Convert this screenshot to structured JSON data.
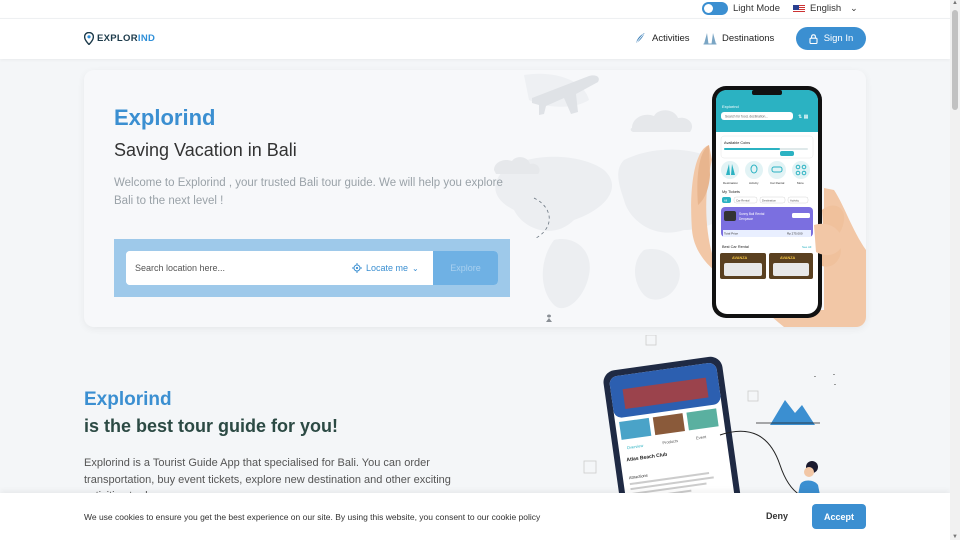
{
  "topbar": {
    "theme_label": "Light Mode",
    "language": "English"
  },
  "nav": {
    "logo_main": "EXPLOR",
    "logo_accent": "IND",
    "activities": "Activities",
    "destinations": "Destinations",
    "signin": "Sign In"
  },
  "hero": {
    "title": "Explorind",
    "subtitle": "Saving Vacation in Bali",
    "description": "Welcome to Explorind , your trusted Bali tour guide. We will help you explore Bali to the next level !",
    "search_placeholder": "Search location here...",
    "locate_label": "Locate me",
    "explore_label": "Explore"
  },
  "phone": {
    "app_name": "Explorind",
    "search_placeholder": "Search for food, destination...",
    "coins_label": "Available Coins",
    "categories": [
      "Destination",
      "Activity",
      "Car Rental",
      "More"
    ],
    "tickets_label": "My Tickets",
    "ticket_filters": [
      "All",
      "Car Rental",
      "Destination",
      "Activity"
    ],
    "ticket_name": "Sunny Bali Rental",
    "ticket_place": "Denpasar",
    "ticket_total_label": "Total Price",
    "ticket_price": "Rp 275.000",
    "best_label": "Best Car Rental",
    "best_more": "See All",
    "car_brands": [
      "AVANZA",
      "AVANZA"
    ]
  },
  "section2": {
    "title_line1": "Explorind",
    "title_line2": "is the best tour guide for you!",
    "description": "Explorind is a Tourist Guide App that specialised for Bali. You can order transportation, buy event tickets, explore new destination and other exciting activities to do.",
    "phone_place": "Atlas Beach Club",
    "phone_tabs": [
      "Overview",
      "Products",
      "Event"
    ],
    "phone_about": "Attractions"
  },
  "cookie": {
    "text": "We use cookies to ensure you get the best experience on our site. By using this website, you consent to our cookie policy",
    "deny": "Deny",
    "accept": "Accept"
  },
  "colors": {
    "primary": "#3b8fd1",
    "dark_green": "#2c4a44",
    "light_blue": "#9ec9ea"
  }
}
